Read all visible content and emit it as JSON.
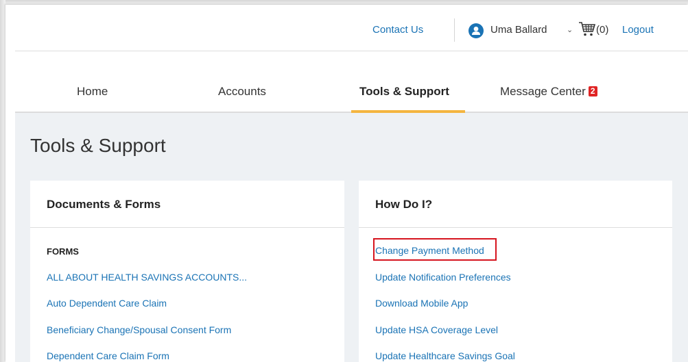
{
  "header": {
    "contact_label": "Contact Us",
    "user_name": "Uma Ballard",
    "user_menu_chevron": "⌄",
    "cart_icon": "cart-icon",
    "cart_count": "(0)",
    "logout_label": "Logout"
  },
  "nav": {
    "tabs": [
      {
        "label": "Home",
        "active": false
      },
      {
        "label": "Accounts",
        "active": false
      },
      {
        "label": "Tools & Support",
        "active": true
      },
      {
        "label": "Message Center",
        "active": false,
        "badge": "2"
      }
    ]
  },
  "page": {
    "title": "Tools & Support"
  },
  "documents_card": {
    "title": "Documents & Forms",
    "section_label": "FORMS",
    "links": [
      "ALL ABOUT HEALTH SAVINGS ACCOUNTS...",
      "Auto Dependent Care Claim",
      "Beneficiary Change/Spousal Consent Form",
      "Dependent Care Claim Form"
    ]
  },
  "how_do_i_card": {
    "title": "How Do I?",
    "links": [
      "Change Payment Method",
      "Update Notification Preferences",
      "Download Mobile App",
      "Update HSA Coverage Level",
      "Update Healthcare Savings Goal"
    ],
    "highlighted_link": "Change Payment Method"
  },
  "colors": {
    "link": "#1a73b5",
    "tab_underline": "#f4b53f",
    "badge": "#e02424",
    "highlight_border": "#d6141e",
    "content_bg": "#eef1f4"
  }
}
